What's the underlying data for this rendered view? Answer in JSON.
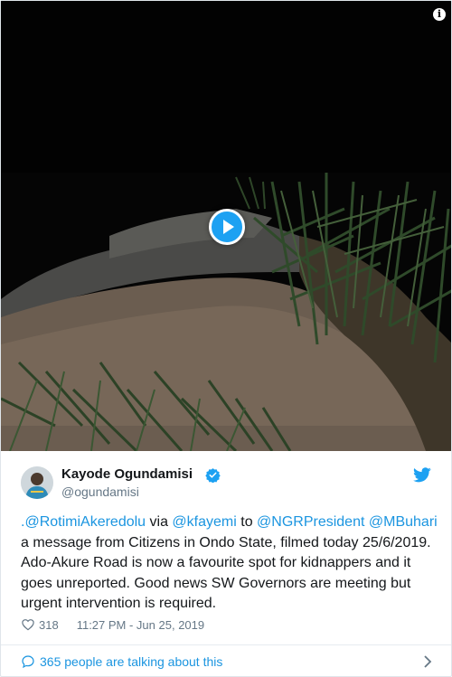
{
  "tweet": {
    "author_name": "Kayode Ogundamisi",
    "author_handle": "@ogundamisi",
    "text_parts": [
      {
        "type": "link",
        "text": ".@RotimiAkeredolu"
      },
      {
        "type": "text",
        "text": " via "
      },
      {
        "type": "link",
        "text": "@kfayemi"
      },
      {
        "type": "text",
        "text": " to "
      },
      {
        "type": "link",
        "text": "@NGRPresident"
      },
      {
        "type": "text",
        "text": " "
      },
      {
        "type": "link",
        "text": "@MBuhari"
      },
      {
        "type": "text",
        "text": " a message from Citizens in Ondo State, filmed today 25/6/2019. Ado-Akure Road is now a favourite spot for kidnappers and it goes unreported. Good news SW Governors are meeting but urgent intervention is required."
      }
    ],
    "likes": "318",
    "timestamp": "11:27 PM - Jun 25, 2019",
    "talking_label": "365 people are talking about this"
  },
  "media": {
    "info_icon": "i",
    "play_icon": "play-icon"
  },
  "colors": {
    "link": "#1b95e0",
    "twitter_blue": "#1da1f2",
    "secondary_text": "#657786"
  },
  "icons": {
    "verified": "verified-badge-icon",
    "twitter": "twitter-bird-icon",
    "heart": "heart-icon",
    "comment": "speech-bubble-icon",
    "chevron": "chevron-right-icon"
  }
}
